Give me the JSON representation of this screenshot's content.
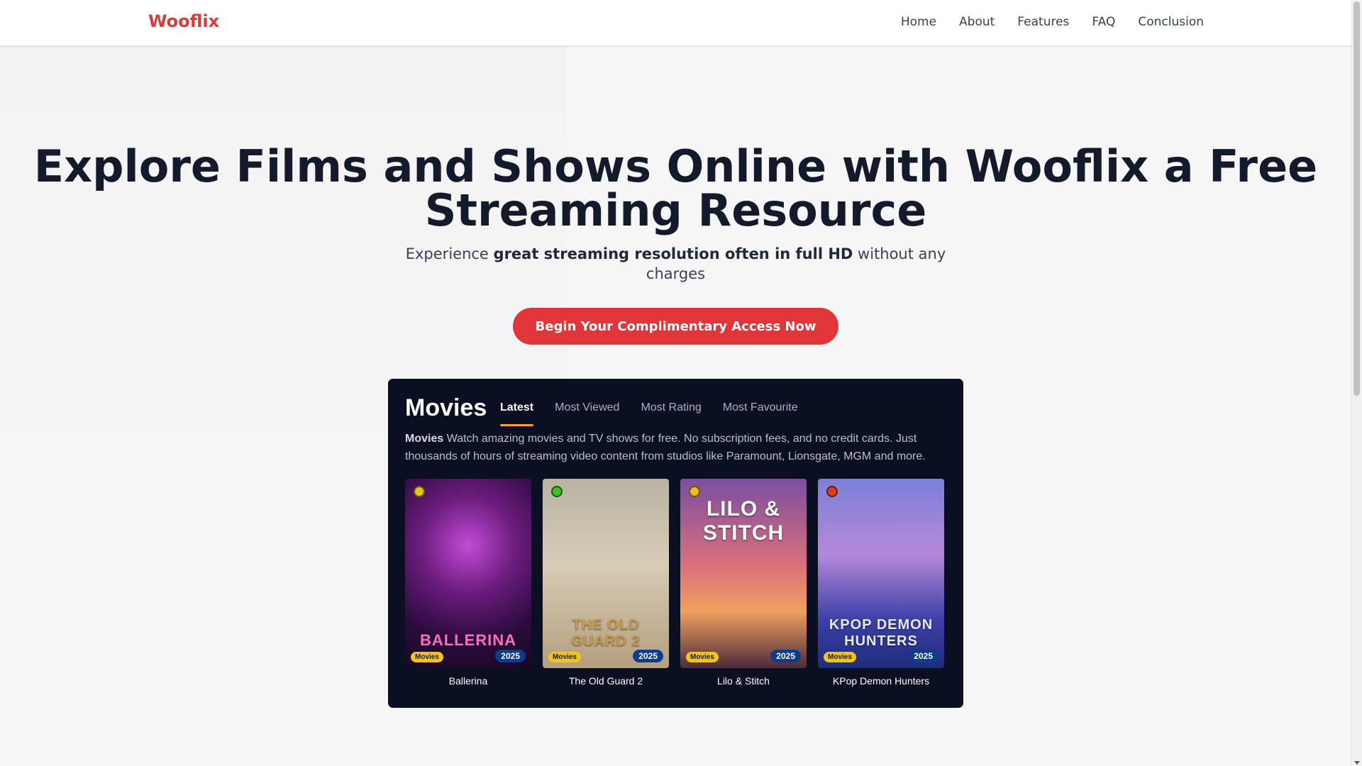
{
  "brand": {
    "logo": "Wooflix",
    "accent": "#dc3b3b"
  },
  "nav": {
    "items": [
      "Home",
      "About",
      "Features",
      "FAQ",
      "Conclusion"
    ]
  },
  "hero": {
    "title": "Explore Films and Shows Online with Wooflix a Free Streaming Resource",
    "subtitle_prefix": "Experience ",
    "subtitle_bold": "great streaming resolution often in full HD",
    "subtitle_suffix": " without any charges",
    "cta_label": "Begin Your Complimentary Access Now"
  },
  "movies_panel": {
    "title": "Movies",
    "tabs": [
      {
        "label": "Latest",
        "active": true
      },
      {
        "label": "Most Viewed",
        "active": false
      },
      {
        "label": "Most Rating",
        "active": false
      },
      {
        "label": "Most Favourite",
        "active": false
      }
    ],
    "description_bold": "Movies",
    "description": " Watch amazing movies and TV shows for free. No subscription fees, and no credit cards. Just thousands of hours of streaming video content from studios like Paramount, Lionsgate, MGM and more.",
    "cards": [
      {
        "title": "Ballerina",
        "poster_text": "BALLERINA",
        "type": "Movies",
        "year": "2025",
        "dot_color": "#e8c21a"
      },
      {
        "title": "The Old Guard 2",
        "poster_text": "THE OLD GUARD 2",
        "type": "Movies",
        "year": "2025",
        "dot_color": "#3fc41f"
      },
      {
        "title": "Lilo & Stitch",
        "poster_text": "LILO & STITCH",
        "type": "Movies",
        "year": "2025",
        "dot_color": "#e8c21a"
      },
      {
        "title": "KPop Demon Hunters",
        "poster_text": "KPOP DEMON HUNTERS",
        "type": "Movies",
        "year": "2025",
        "dot_color": "#d9401f"
      }
    ]
  }
}
